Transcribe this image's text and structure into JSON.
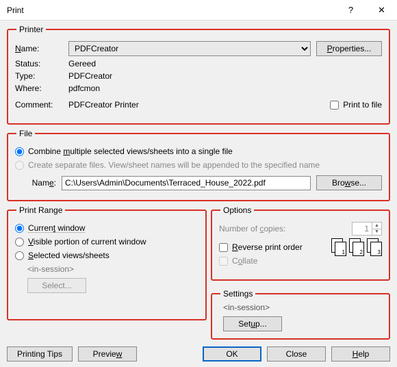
{
  "title": "Print",
  "titlebar": {
    "help": "?",
    "close": "✕"
  },
  "printer": {
    "legend": "Printer",
    "name_label": "Name:",
    "name_value": "PDFCreator",
    "properties_btn": "Properties...",
    "status_label": "Status:",
    "status_value": "Gereed",
    "type_label": "Type:",
    "type_value": "PDFCreator",
    "where_label": "Where:",
    "where_value": "pdfcmon",
    "comment_label": "Comment:",
    "comment_value": "PDFCreator Printer",
    "print_to_file": "Print to file"
  },
  "file": {
    "legend": "File",
    "combine": "Combine multiple selected views/sheets into a single file",
    "separate": "Create separate files. View/sheet names will be appended to the specified name",
    "name_label": "Name:",
    "path": "C:\\Users\\Admin\\Documents\\Terraced_House_2022.pdf",
    "browse_btn": "Browse..."
  },
  "range": {
    "legend": "Print Range",
    "current": "Current window",
    "visible": "Visible portion of current window",
    "selected": "Selected views/sheets",
    "in_session": "<in-session>",
    "select_btn": "Select..."
  },
  "options": {
    "legend": "Options",
    "copies_label": "Number of copies:",
    "copies_value": "1",
    "reverse": "Reverse print order",
    "collate": "Collate"
  },
  "settings": {
    "legend": "Settings",
    "in_session": "<in-session>",
    "setup_btn": "Setup..."
  },
  "footer": {
    "tips": "Printing Tips",
    "preview": "Preview",
    "ok": "OK",
    "close": "Close",
    "help": "Help"
  }
}
